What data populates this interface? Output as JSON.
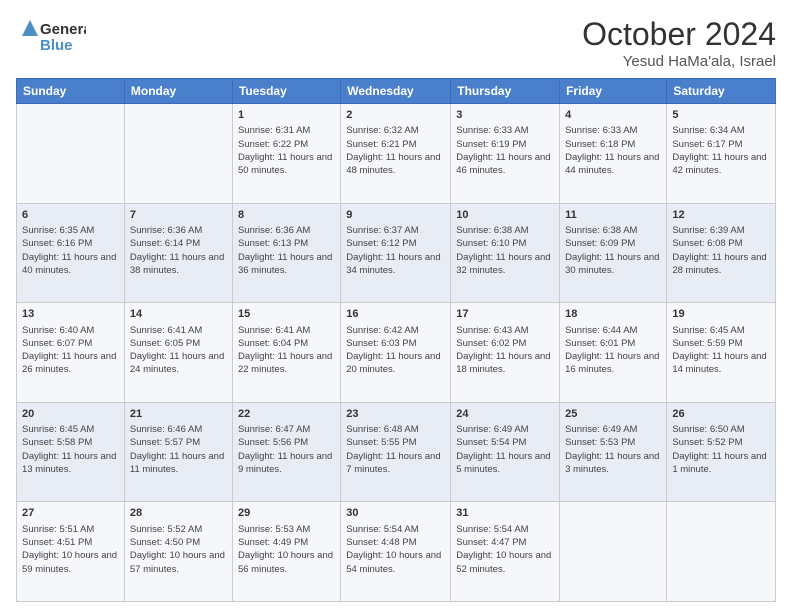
{
  "logo": {
    "line1": "General",
    "line2": "Blue"
  },
  "title": "October 2024",
  "subtitle": "Yesud HaMa'ala, Israel",
  "headers": [
    "Sunday",
    "Monday",
    "Tuesday",
    "Wednesday",
    "Thursday",
    "Friday",
    "Saturday"
  ],
  "rows": [
    [
      {
        "day": "",
        "info": ""
      },
      {
        "day": "",
        "info": ""
      },
      {
        "day": "1",
        "info": "Sunrise: 6:31 AM\nSunset: 6:22 PM\nDaylight: 11 hours and 50 minutes."
      },
      {
        "day": "2",
        "info": "Sunrise: 6:32 AM\nSunset: 6:21 PM\nDaylight: 11 hours and 48 minutes."
      },
      {
        "day": "3",
        "info": "Sunrise: 6:33 AM\nSunset: 6:19 PM\nDaylight: 11 hours and 46 minutes."
      },
      {
        "day": "4",
        "info": "Sunrise: 6:33 AM\nSunset: 6:18 PM\nDaylight: 11 hours and 44 minutes."
      },
      {
        "day": "5",
        "info": "Sunrise: 6:34 AM\nSunset: 6:17 PM\nDaylight: 11 hours and 42 minutes."
      }
    ],
    [
      {
        "day": "6",
        "info": "Sunrise: 6:35 AM\nSunset: 6:16 PM\nDaylight: 11 hours and 40 minutes."
      },
      {
        "day": "7",
        "info": "Sunrise: 6:36 AM\nSunset: 6:14 PM\nDaylight: 11 hours and 38 minutes."
      },
      {
        "day": "8",
        "info": "Sunrise: 6:36 AM\nSunset: 6:13 PM\nDaylight: 11 hours and 36 minutes."
      },
      {
        "day": "9",
        "info": "Sunrise: 6:37 AM\nSunset: 6:12 PM\nDaylight: 11 hours and 34 minutes."
      },
      {
        "day": "10",
        "info": "Sunrise: 6:38 AM\nSunset: 6:10 PM\nDaylight: 11 hours and 32 minutes."
      },
      {
        "day": "11",
        "info": "Sunrise: 6:38 AM\nSunset: 6:09 PM\nDaylight: 11 hours and 30 minutes."
      },
      {
        "day": "12",
        "info": "Sunrise: 6:39 AM\nSunset: 6:08 PM\nDaylight: 11 hours and 28 minutes."
      }
    ],
    [
      {
        "day": "13",
        "info": "Sunrise: 6:40 AM\nSunset: 6:07 PM\nDaylight: 11 hours and 26 minutes."
      },
      {
        "day": "14",
        "info": "Sunrise: 6:41 AM\nSunset: 6:05 PM\nDaylight: 11 hours and 24 minutes."
      },
      {
        "day": "15",
        "info": "Sunrise: 6:41 AM\nSunset: 6:04 PM\nDaylight: 11 hours and 22 minutes."
      },
      {
        "day": "16",
        "info": "Sunrise: 6:42 AM\nSunset: 6:03 PM\nDaylight: 11 hours and 20 minutes."
      },
      {
        "day": "17",
        "info": "Sunrise: 6:43 AM\nSunset: 6:02 PM\nDaylight: 11 hours and 18 minutes."
      },
      {
        "day": "18",
        "info": "Sunrise: 6:44 AM\nSunset: 6:01 PM\nDaylight: 11 hours and 16 minutes."
      },
      {
        "day": "19",
        "info": "Sunrise: 6:45 AM\nSunset: 5:59 PM\nDaylight: 11 hours and 14 minutes."
      }
    ],
    [
      {
        "day": "20",
        "info": "Sunrise: 6:45 AM\nSunset: 5:58 PM\nDaylight: 11 hours and 13 minutes."
      },
      {
        "day": "21",
        "info": "Sunrise: 6:46 AM\nSunset: 5:57 PM\nDaylight: 11 hours and 11 minutes."
      },
      {
        "day": "22",
        "info": "Sunrise: 6:47 AM\nSunset: 5:56 PM\nDaylight: 11 hours and 9 minutes."
      },
      {
        "day": "23",
        "info": "Sunrise: 6:48 AM\nSunset: 5:55 PM\nDaylight: 11 hours and 7 minutes."
      },
      {
        "day": "24",
        "info": "Sunrise: 6:49 AM\nSunset: 5:54 PM\nDaylight: 11 hours and 5 minutes."
      },
      {
        "day": "25",
        "info": "Sunrise: 6:49 AM\nSunset: 5:53 PM\nDaylight: 11 hours and 3 minutes."
      },
      {
        "day": "26",
        "info": "Sunrise: 6:50 AM\nSunset: 5:52 PM\nDaylight: 11 hours and 1 minute."
      }
    ],
    [
      {
        "day": "27",
        "info": "Sunrise: 5:51 AM\nSunset: 4:51 PM\nDaylight: 10 hours and 59 minutes."
      },
      {
        "day": "28",
        "info": "Sunrise: 5:52 AM\nSunset: 4:50 PM\nDaylight: 10 hours and 57 minutes."
      },
      {
        "day": "29",
        "info": "Sunrise: 5:53 AM\nSunset: 4:49 PM\nDaylight: 10 hours and 56 minutes."
      },
      {
        "day": "30",
        "info": "Sunrise: 5:54 AM\nSunset: 4:48 PM\nDaylight: 10 hours and 54 minutes."
      },
      {
        "day": "31",
        "info": "Sunrise: 5:54 AM\nSunset: 4:47 PM\nDaylight: 10 hours and 52 minutes."
      },
      {
        "day": "",
        "info": ""
      },
      {
        "day": "",
        "info": ""
      }
    ]
  ]
}
